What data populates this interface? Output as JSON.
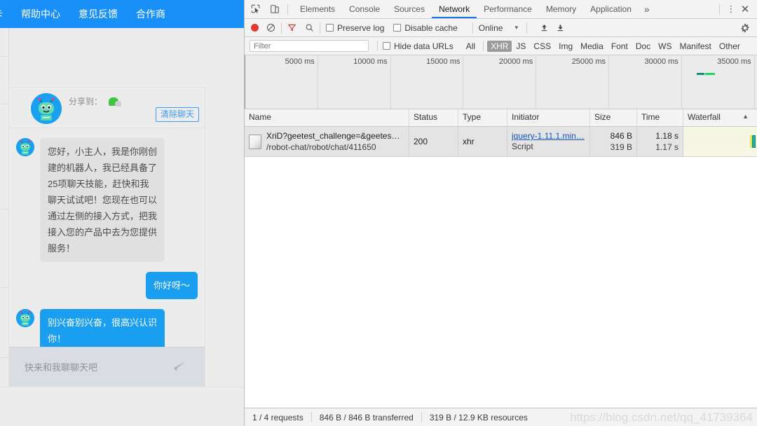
{
  "webpage": {
    "topbar": {
      "cut_item": "卡",
      "items": [
        "帮助中心",
        "意见反馈",
        "合作商"
      ]
    },
    "chat": {
      "share_label": "分享到：",
      "share_icon": "wechat-icon",
      "clear_button": "清除聊天",
      "messages": [
        {
          "side": "left",
          "style": "bot",
          "text": "您好，小主人，我是你刚创建的机器人，我已经具备了25项聊天技能，赶快和我聊天试试吧！您现在也可以通过左侧的接入方式，把我接入您的产品中去为您提供服务！"
        },
        {
          "side": "right",
          "style": "user",
          "text": "你好呀～"
        },
        {
          "side": "left",
          "style": "blue",
          "text": "别兴奋别兴奋，很高兴认识你！"
        }
      ],
      "input_placeholder": "快来和我聊聊天吧",
      "send_icon": "send-paper-plane-icon"
    },
    "accent_color": "#1890f7"
  },
  "devtools": {
    "tabs": {
      "inspect_icon": "inspect-element-icon",
      "device_icon": "device-toolbar-icon",
      "items": [
        "Elements",
        "Console",
        "Sources",
        "Network",
        "Performance",
        "Memory",
        "Application"
      ],
      "active": "Network",
      "overflow": "»",
      "kebab_icon": "more-options-icon",
      "close_icon": "close-icon"
    },
    "toolbar": {
      "record_icon": "record-stop-icon",
      "clear_icon": "clear-icon",
      "filter_icon": "filter-funnel-icon",
      "search_icon": "search-icon",
      "preserve_log": "Preserve log",
      "preserve_log_checked": false,
      "disable_cache": "Disable cache",
      "disable_cache_checked": false,
      "throttle_value": "Online",
      "throttle_caret": "▾",
      "import_icon": "import-har-icon",
      "export_icon": "export-har-icon",
      "settings_icon": "gear-icon"
    },
    "filterbar": {
      "filter_placeholder": "Filter",
      "filter_value": "",
      "hide_data_urls": "Hide data URLs",
      "hide_data_urls_checked": false,
      "types": [
        "All",
        "XHR",
        "JS",
        "CSS",
        "Img",
        "Media",
        "Font",
        "Doc",
        "WS",
        "Manifest",
        "Other"
      ],
      "selected_type": "XHR"
    },
    "overview": {
      "ticks": [
        "5000 ms",
        "10000 ms",
        "15000 ms",
        "20000 ms",
        "25000 ms",
        "30000 ms",
        "35000 ms"
      ],
      "bars": [
        {
          "color": "#0f8f80",
          "left_pct": 88.2,
          "width_pct": 1.5
        },
        {
          "color": "#1fd75b",
          "left_pct": 89.7,
          "width_pct": 1.9
        }
      ]
    },
    "table": {
      "columns": [
        "Name",
        "Status",
        "Type",
        "Initiator",
        "Size",
        "Time",
        "Waterfall"
      ],
      "sort_indicator": "▲",
      "rows": [
        {
          "icon": "xhr-document-icon",
          "name_line1": "XriD?geetest_challenge=&geetes…",
          "name_line2": "/robot-chat/robot/chat/411650",
          "status": "200",
          "type": "xhr",
          "initiator_link": "jquery-1.11.1.min…",
          "initiator_sub": "Script",
          "size_line1": "846 B",
          "size_line2": "319 B",
          "time_line1": "1.18 s",
          "time_line2": "1.17 s"
        }
      ]
    },
    "status": {
      "requests": "1 / 4 requests",
      "transferred": "846 B / 846 B transferred",
      "resources": "319 B / 12.9 KB resources"
    }
  },
  "watermark": "https://blog.csdn.net/qq_41739364"
}
